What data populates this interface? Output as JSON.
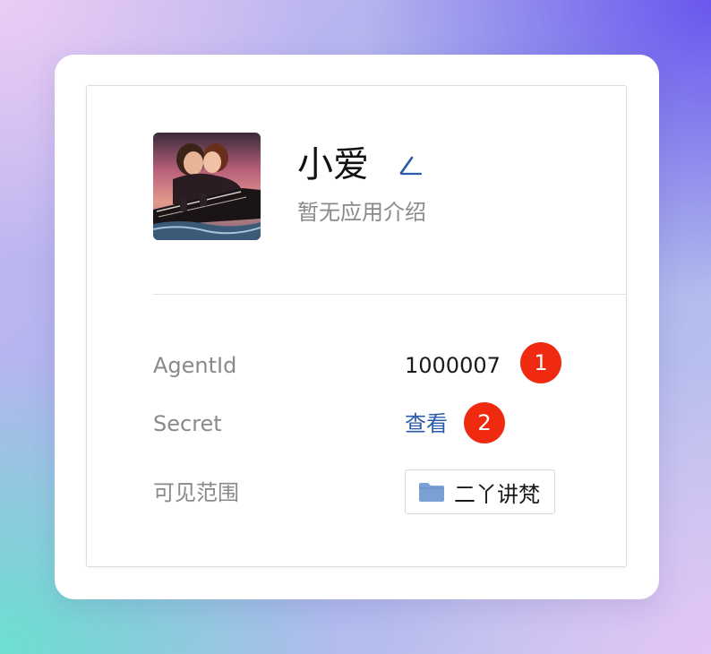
{
  "app": {
    "name": "小爱",
    "description": "暂无应用介绍"
  },
  "details": {
    "agentid": {
      "label": "AgentId",
      "value": "1000007",
      "badge": "1"
    },
    "secret": {
      "label": "Secret",
      "value": "查看",
      "badge": "2"
    },
    "scope": {
      "label": "可见范围",
      "value": "二丫讲梵"
    }
  },
  "icons": {
    "edit": "pencil-icon",
    "folder": "folder-icon"
  },
  "colors": {
    "link": "#2a5aa8",
    "badge": "#f02a10",
    "folder": "#7aa0d4"
  }
}
